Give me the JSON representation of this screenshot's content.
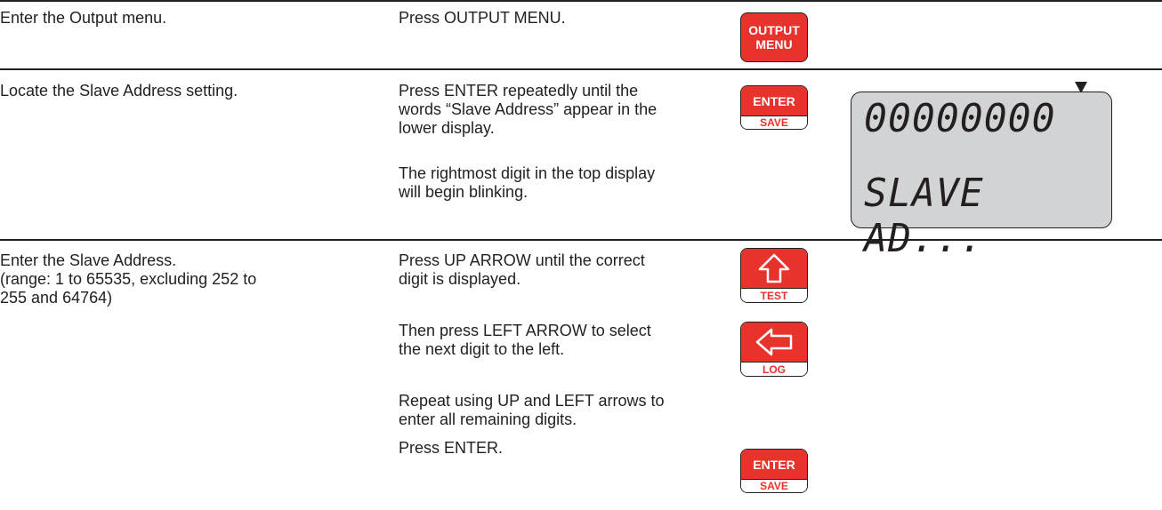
{
  "rows": [
    {
      "step": [
        "Enter the Output menu."
      ],
      "action": [
        "Press OUTPUT MENU."
      ]
    },
    {
      "step": [
        "Locate the Slave Address setting."
      ],
      "action": [
        "Press ENTER repeatedly until the",
        "words “Slave Address” appear in the",
        "lower display."
      ],
      "note": [
        "The rightmost digit in the top display",
        "will begin blinking."
      ]
    },
    {
      "step": [
        "Enter the Slave Address.",
        "(range: 1 to 65535, excluding 252 to",
        "255 and 64764)"
      ],
      "actions": [
        [
          "Press UP ARROW until the correct",
          "digit is displayed."
        ],
        [
          "Then press LEFT ARROW to select",
          "the next digit to the left."
        ],
        [
          "Repeat using UP and LEFT arrows to",
          "enter all remaining digits."
        ],
        [
          "Press ENTER."
        ]
      ]
    }
  ],
  "keys": {
    "output_menu": [
      "OUTPUT",
      "MENU"
    ],
    "enter_top": "ENTER",
    "enter_bottom": "SAVE",
    "up_bottom": "TEST",
    "left_bottom": "LOG"
  },
  "display": {
    "top_line": "00000000",
    "bottom_line": "SLAVE AD..."
  },
  "colors": {
    "key_red": "#e8322c",
    "lcd_gray": "#d2d3d5",
    "ink": "#231f20"
  }
}
